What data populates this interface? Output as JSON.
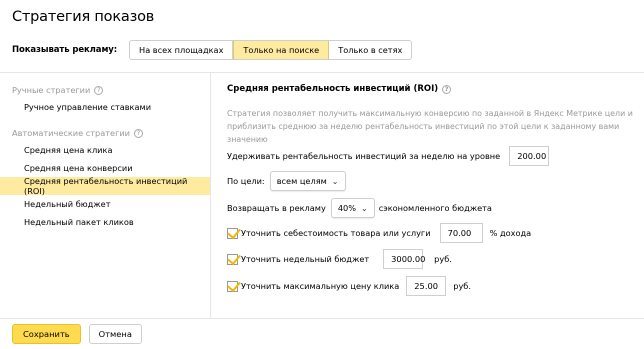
{
  "dialog": {
    "title": "Стратегия показов"
  },
  "show_ads": {
    "label": "Показывать рекламу:",
    "options": [
      "На всех площадках",
      "Только на поиске",
      "Только в сетях"
    ],
    "selected": "Только на поиске"
  },
  "sidebar": {
    "manual_group": {
      "title": "Ручные стратегии",
      "help": "?"
    },
    "manual_items": [
      "Ручное управление ставками"
    ],
    "auto_group": {
      "title": "Автоматические стратегии",
      "help": "?"
    },
    "auto_items": [
      "Средняя цена клика",
      "Средняя цена конверсии",
      "Средняя рентабельность инвестиций (ROI)",
      "Недельный бюджет",
      "Недельный пакет кликов"
    ],
    "active_item": "Средняя рентабельность инвестиций (ROI)"
  },
  "content": {
    "heading": "Средняя рентабельность инвестиций (ROI)",
    "help": "?",
    "description_line1": "Стратегия позволяет получить максимальную конверсию по заданной в Яндекс Метрике цели и",
    "description_line2": "приблизить среднюю за неделю рентабельность инвестиций по этой цели к заданному вами значению",
    "roi_label": "Удерживать рентабельность инвестиций за неделю на уровне",
    "roi_value": "200.00",
    "goal_label": "По цели:",
    "goal_value": "всем целям",
    "return_label_pre": "Возвращать в рекламу",
    "return_value": "40%",
    "return_label_post": "сэкономленного бюджета",
    "cost_label": "Уточнить себестоимость товара или услуги",
    "cost_value": "70.00",
    "cost_unit": "% дохода",
    "budget_label": "Уточнить недельный бюджет",
    "budget_value": "3000.00",
    "budget_unit": "руб.",
    "max_price_label": "Уточнить максимальную цену клика",
    "max_price_value": "25.00",
    "max_price_unit": "руб."
  },
  "footer": {
    "save": "Сохранить",
    "cancel": "Отмена"
  },
  "colors": {
    "accent": "#ffdb4d",
    "selected_bg": "#ffeba0",
    "check": "#f2b600",
    "muted_text": "#999999"
  }
}
